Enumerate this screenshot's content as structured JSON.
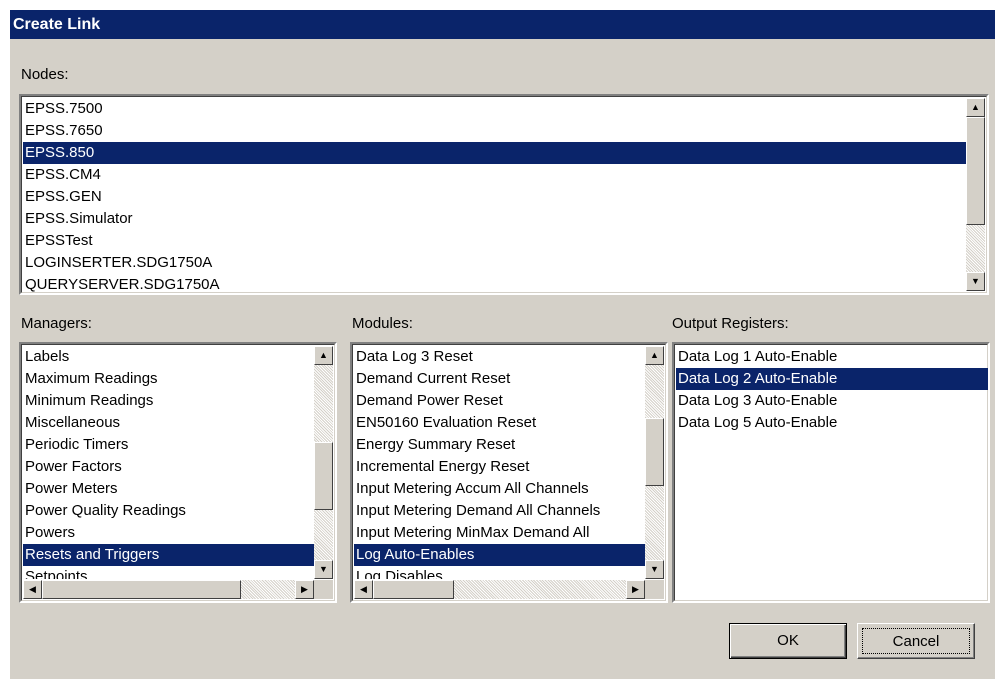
{
  "dialog": {
    "title": "Create Link"
  },
  "nodes": {
    "label": "Nodes:",
    "items": [
      "EPSS.7500",
      "EPSS.7650",
      "EPSS.850",
      "EPSS.CM4",
      "EPSS.GEN",
      "EPSS.Simulator",
      "EPSSTest",
      "LOGINSERTER.SDG1750A",
      "QUERYSERVER.SDG1750A"
    ],
    "selected": "EPSS.850"
  },
  "managers": {
    "label": "Managers:",
    "items": [
      "Labels",
      "Maximum Readings",
      "Minimum Readings",
      "Miscellaneous",
      "Periodic Timers",
      "Power Factors",
      "Power Meters",
      "Power Quality Readings",
      "Powers",
      "Resets and Triggers",
      "Setpoints"
    ],
    "selected": "Resets and Triggers"
  },
  "modules": {
    "label": "Modules:",
    "items": [
      "Data Log 3 Reset",
      "Demand Current Reset",
      "Demand Power Reset",
      "EN50160 Evaluation Reset",
      "Energy Summary Reset",
      "Incremental Energy Reset",
      "Input Metering Accum All Channels",
      "Input Metering Demand All Channels",
      "Input Metering MinMax Demand All",
      "Log Auto-Enables",
      "Log Disables"
    ],
    "selected": "Log Auto-Enables"
  },
  "output_registers": {
    "label": "Output Registers:",
    "items": [
      "Data Log 1 Auto-Enable",
      "Data Log 2 Auto-Enable",
      "Data Log 3 Auto-Enable",
      "Data Log 5 Auto-Enable"
    ],
    "selected": "Data Log 2 Auto-Enable"
  },
  "buttons": {
    "ok": "OK",
    "cancel": "Cancel"
  },
  "icons": {
    "up": "arrow-up-icon",
    "down": "arrow-down-icon",
    "left": "arrow-left-icon",
    "right": "arrow-right-icon"
  },
  "colors": {
    "titlebar": "#0a246a",
    "selection": "#0a246a",
    "dialog_bg": "#d4d0c8"
  }
}
